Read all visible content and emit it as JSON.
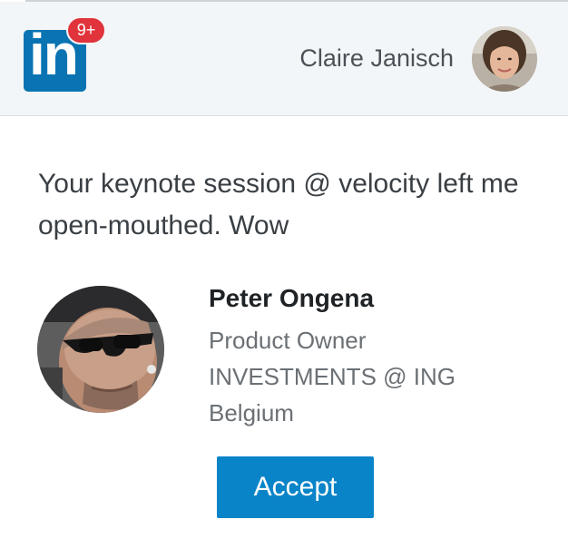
{
  "header": {
    "logo_text": "in",
    "notification_badge": "9+",
    "user_name": "Claire Janisch",
    "avatar_icon": "user-avatar-photo"
  },
  "message": {
    "text": "Your keynote session @ velocity left me open-mouthed. Wow"
  },
  "profile": {
    "name": "Peter Ongena",
    "title": "Product Owner",
    "company": "INVESTMENTS @ ING",
    "location": "Belgium",
    "photo_icon": "profile-photo"
  },
  "actions": {
    "accept_label": "Accept"
  },
  "colors": {
    "brand": "#0a74b2",
    "accept_button": "#0a84c8",
    "badge": "#e0333b",
    "header_bg": "#f3f6f8"
  }
}
